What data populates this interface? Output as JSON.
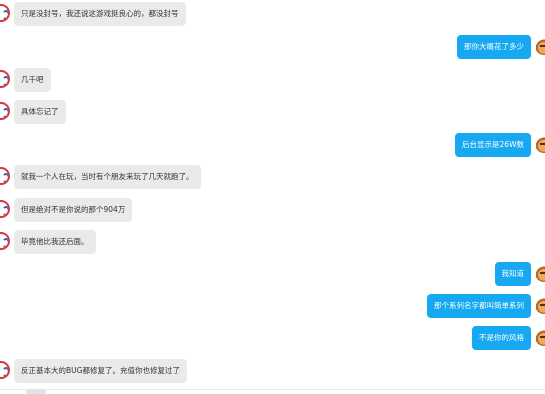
{
  "messages": [
    {
      "side": "left",
      "text": "只是没封号，我还说这游戏挺良心的，都没封号"
    },
    {
      "side": "right",
      "text": "那你大概花了多少"
    },
    {
      "side": "left",
      "text": "几千吧"
    },
    {
      "side": "left",
      "text": "具体忘记了"
    },
    {
      "side": "right",
      "text": "后台显示是26W数"
    },
    {
      "side": "left",
      "text": "就我一个人在玩，当时有个朋友来玩了几天就跑了。"
    },
    {
      "side": "left",
      "text": "但是绝对不是你说的那个904万"
    },
    {
      "side": "left",
      "text": "毕竟他比我还后面。"
    },
    {
      "side": "right",
      "text": "我知道"
    },
    {
      "side": "right",
      "text": "那个系列名字都叫简单系列"
    },
    {
      "side": "right",
      "text": "不是你的风格"
    },
    {
      "side": "left",
      "text": "反正基本大的BUG都修复了。充值你也修复过了"
    }
  ],
  "colors": {
    "outgoing_bubble": "#16a8f0",
    "incoming_bubble": "#eaeaea",
    "incoming_text": "#333333",
    "outgoing_text": "#ffffff"
  },
  "icons": {
    "incoming_avatar": "red-ring-avatar-icon",
    "outgoing_avatar": "tiger-avatar-icon"
  }
}
